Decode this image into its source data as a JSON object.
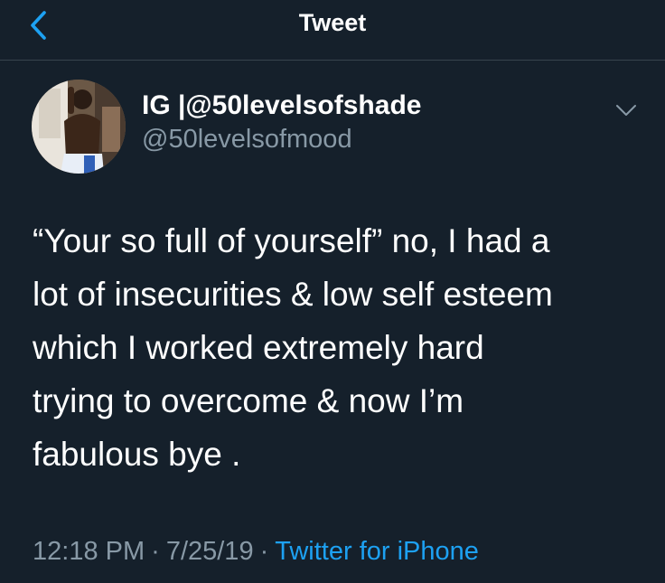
{
  "header": {
    "title": "Tweet",
    "back_icon": "chevron-left-icon",
    "accent_color": "#1da1f2"
  },
  "author": {
    "display_name": "IG |@50levelsofshade",
    "handle": "@50levelsofmood",
    "more_icon": "chevron-down-icon"
  },
  "tweet": {
    "lines": [
      "“Your so full of yourself” no, I had a",
      "lot of insecurities & low self esteem",
      "which I worked extremely hard",
      "trying to overcome & now I’m",
      "fabulous bye ."
    ],
    "time": "12:18 PM",
    "date": "7/25/19",
    "separator": "·",
    "source": "Twitter for iPhone"
  },
  "colors": {
    "background": "#15202b",
    "secondary_text": "#8899a6",
    "divider": "#38444d"
  }
}
